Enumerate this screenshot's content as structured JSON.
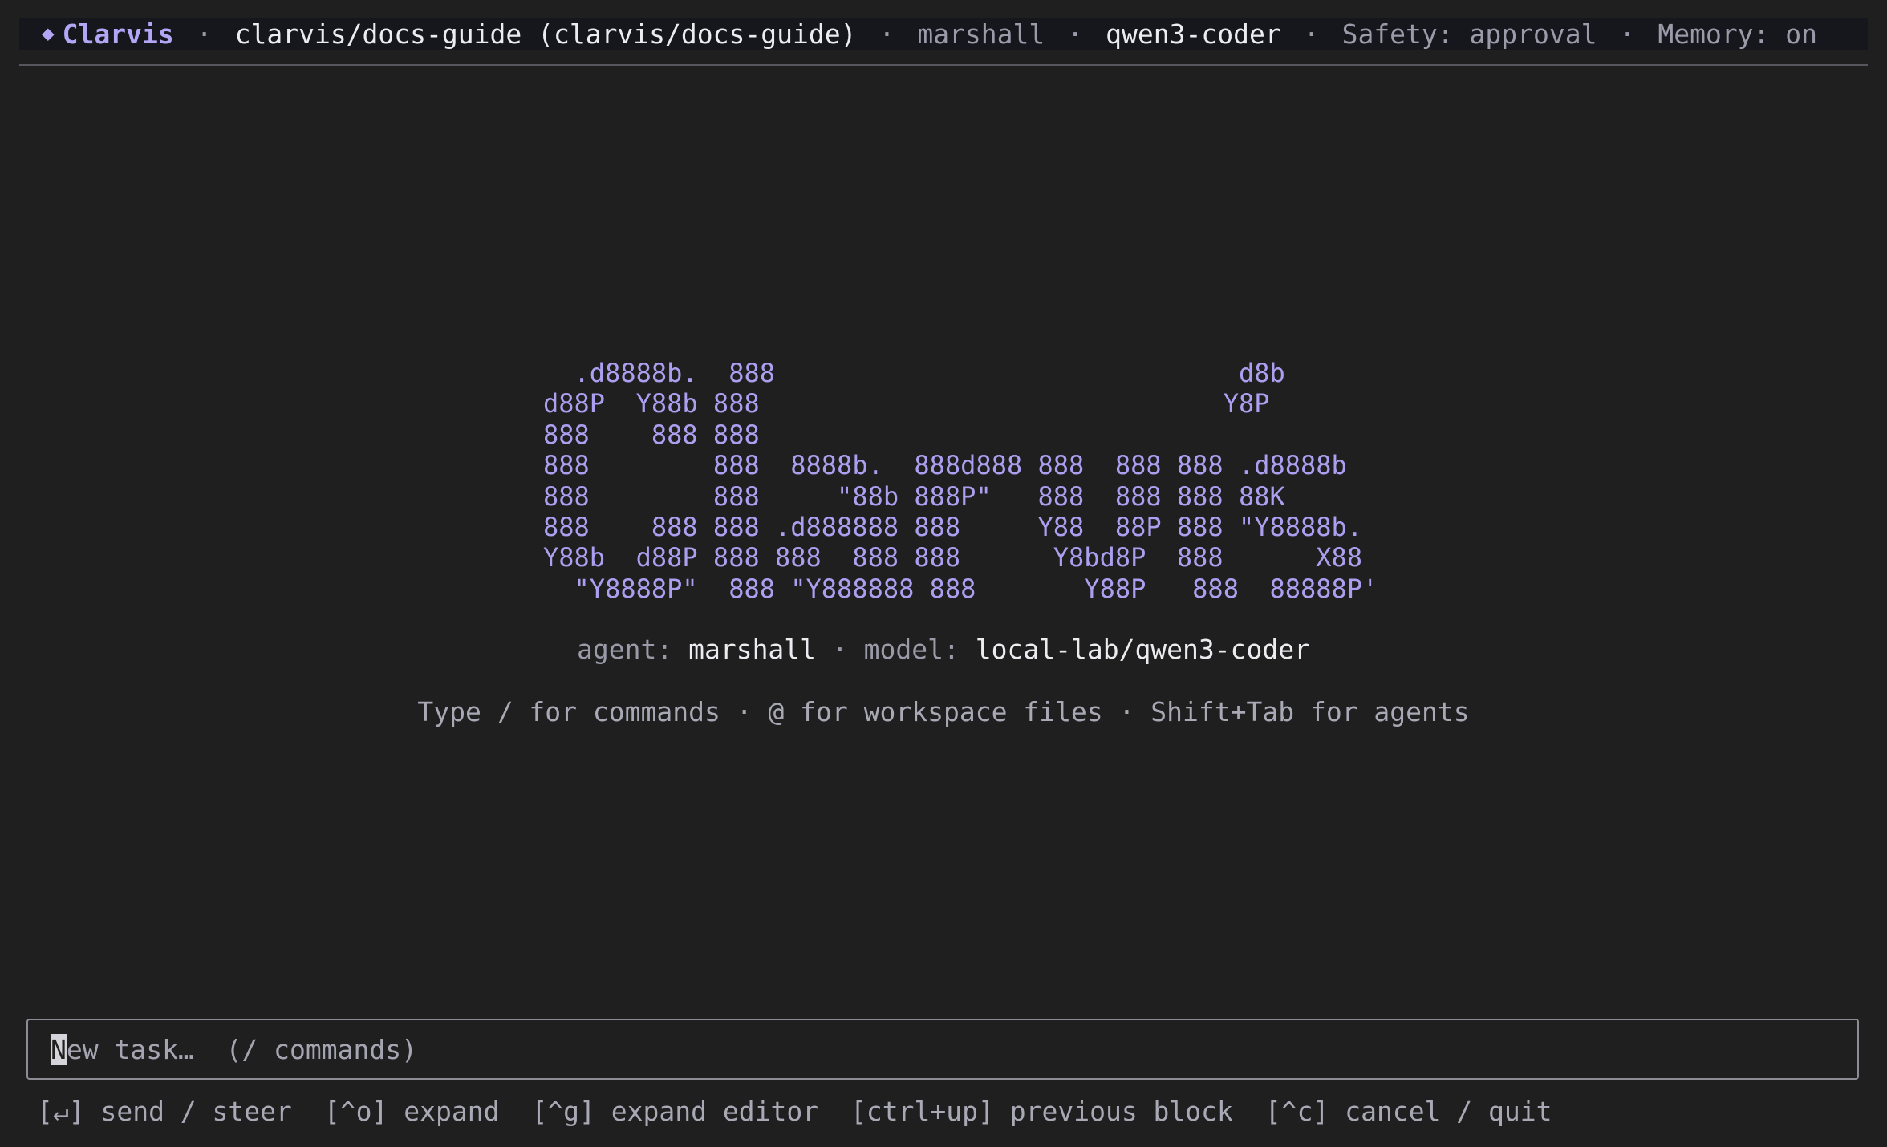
{
  "header": {
    "brand_icon": "diamond-icon",
    "brand": "Clarvis",
    "separator": "·",
    "repo": "clarvis/docs-guide (clarvis/docs-guide)",
    "user": "marshall",
    "model": "qwen3-coder",
    "safety": "Safety: approval",
    "memory": "Memory: on"
  },
  "logo": {
    "ascii": "  .d8888b.  888                              d8b\nd88P  Y88b 888                              Y8P\n888    888 888\n888        888  8888b.  888d888 888  888 888 .d8888b\n888        888     \"88b 888P\"   888  888 888 88K\n888    888 888 .d888888 888     Y88  88P 888 \"Y8888b.\nY88b  d88P 888 888  888 888      Y8bd8P  888      X88\n  \"Y8888P\"  888 \"Y888888 888       Y88P   888  88888P'"
  },
  "info": {
    "agent_label": "agent:",
    "agent_value": "marshall",
    "separator": "·",
    "model_label": "model:",
    "model_value": "local-lab/qwen3-coder"
  },
  "hint": "Type / for commands · @ for workspace files · Shift+Tab for agents",
  "input": {
    "cursor_char": "N",
    "placeholder_rest": "ew task…  (/ commands)"
  },
  "footer": {
    "send": "[↵] send / steer",
    "expand": "[^o] expand",
    "expand_editor": "[^g] expand editor",
    "previous_block": "[ctrl+up] previous block",
    "cancel": "[^c] cancel / quit"
  },
  "colors": {
    "background": "#1f1f1f",
    "header_background": "#16171c",
    "accent": "#b4a6f6",
    "logo": "#ab9ff0",
    "muted_text": "#9a9aa8",
    "bright_text": "#ececf0"
  }
}
